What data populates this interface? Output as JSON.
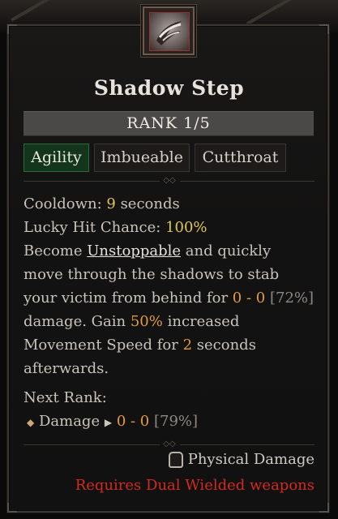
{
  "skill": {
    "name": "Shadow Step",
    "rank": "RANK 1/5",
    "icon": "shadow-step-skill-icon"
  },
  "tags": [
    "Agility",
    "Imbueable",
    "Cutthroat"
  ],
  "stats": {
    "cooldown_label": "Cooldown:",
    "cooldown_value": "9",
    "cooldown_unit": "seconds",
    "lucky_label": "Lucky Hit Chance:",
    "lucky_value": "100%"
  },
  "description": {
    "l1_a": "Become ",
    "l1_kw": "Unstoppable",
    "l1_b": " and quickly",
    "l2": "move through the shadows to stab",
    "l3_a": "your victim from behind for ",
    "l3_dmg": "0 - 0",
    "l3_pct": "[72%]",
    "l4_a": " damage. Gain ",
    "l4_val": "50%",
    "l4_b": " increased",
    "l5_a": "Movement Speed for ",
    "l5_val": "2",
    "l5_b": " seconds",
    "l6": "afterwards."
  },
  "next_rank": {
    "label": "Next Rank:",
    "item_label": "Damage",
    "item_value": "0 - 0",
    "item_pct": "[79%]"
  },
  "damage_type": "Physical Damage",
  "requirement": "Requires Dual Wielded weapons",
  "colors": {
    "highlight_yellow": "#e0c45a",
    "highlight_orange": "#e49a3c",
    "requirement_red": "#d22a1e",
    "active_tag_green": "#13351c"
  }
}
